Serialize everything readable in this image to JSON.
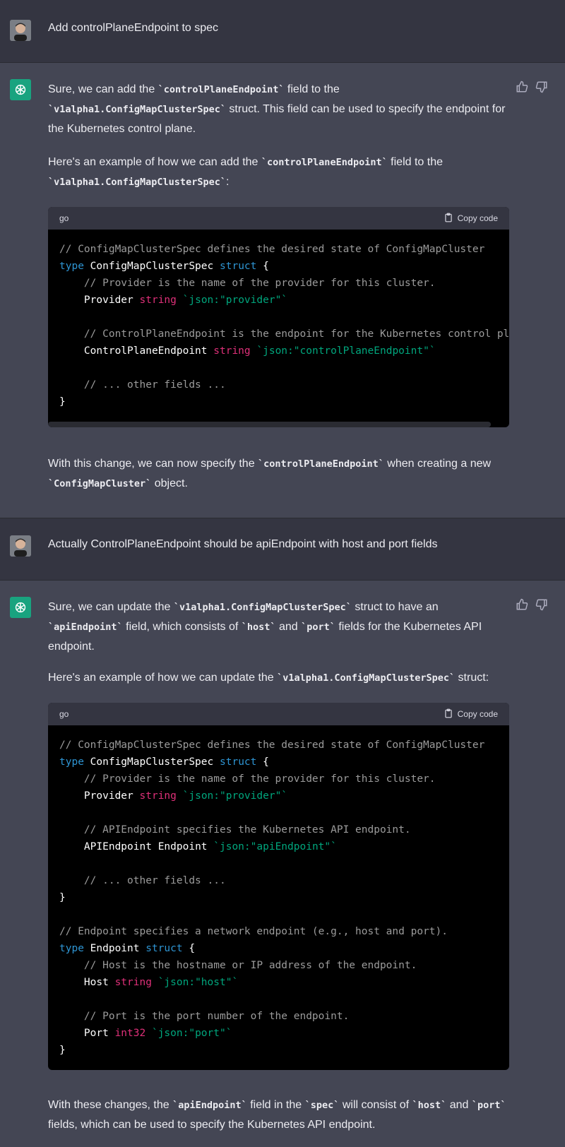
{
  "messages": {
    "user1": "Add controlPlaneEndpoint to spec",
    "asst1": {
      "p1_a": "Sure, we can add the ",
      "p1_code1": "`controlPlaneEndpoint`",
      "p1_b": " field to the ",
      "p1_code2": "`v1alpha1.ConfigMapClusterSpec`",
      "p1_c": " struct. This field can be used to specify the endpoint for the Kubernetes control plane.",
      "p2_a": "Here's an example of how we can add the ",
      "p2_code1": "`controlPlaneEndpoint`",
      "p2_b": " field to the ",
      "p2_code2": "`v1alpha1.ConfigMapClusterSpec`",
      "p2_c": ":",
      "p3_a": "With this change, we can now specify the ",
      "p3_code1": "`controlPlaneEndpoint`",
      "p3_b": " when creating a new ",
      "p3_code2": "`ConfigMapCluster`",
      "p3_c": " object."
    },
    "user2": "Actually ControlPlaneEndpoint should be apiEndpoint with host and port fields",
    "asst2": {
      "p1_a": "Sure, we can update the ",
      "p1_code1": "`v1alpha1.ConfigMapClusterSpec`",
      "p1_b": " struct to have an ",
      "p1_code2": "`apiEndpoint`",
      "p1_c": " field, which consists of ",
      "p1_code3": "`host`",
      "p1_d": " and ",
      "p1_code4": "`port`",
      "p1_e": " fields for the Kubernetes API endpoint.",
      "p2_a": "Here's an example of how we can update the ",
      "p2_code1": "`v1alpha1.ConfigMapClusterSpec`",
      "p2_b": " struct:",
      "p3_a": "With these changes, the ",
      "p3_code1": "`apiEndpoint`",
      "p3_b": " field in the ",
      "p3_code2": "`spec`",
      "p3_c": " will consist of ",
      "p3_code3": "`host`",
      "p3_d": " and ",
      "p3_code4": "`port`",
      "p3_e": " fields, which can be used to specify the Kubernetes API endpoint."
    }
  },
  "codeblock": {
    "language": "go",
    "copy_label": "Copy code"
  },
  "code1": {
    "l1": "// ConfigMapClusterSpec defines the desired state of ConfigMapCluster",
    "type": "type",
    "name": "ConfigMapClusterSpec",
    "struct": "struct",
    "open": "{",
    "l3": "// Provider is the name of the provider for this cluster.",
    "provider": "Provider",
    "string": "string",
    "provider_tag": "`json:\"provider\"`",
    "l6": "// ControlPlaneEndpoint is the endpoint for the Kubernetes control plane",
    "cpe": "ControlPlaneEndpoint",
    "cpe_tag": "`json:\"controlPlaneEndpoint\"`",
    "other": "// ... other fields ...",
    "close": "}"
  },
  "code2": {
    "l1": "// ConfigMapClusterSpec defines the desired state of ConfigMapCluster",
    "type": "type",
    "name": "ConfigMapClusterSpec",
    "struct": "struct",
    "open": "{",
    "l3": "// Provider is the name of the provider for this cluster.",
    "provider": "Provider",
    "string": "string",
    "provider_tag": "`json:\"provider\"`",
    "l6": "// APIEndpoint specifies the Kubernetes API endpoint.",
    "api": "APIEndpoint",
    "endpoint_type": "Endpoint",
    "api_tag": "`json:\"apiEndpoint\"`",
    "other": "// ... other fields ...",
    "close": "}",
    "l12": "// Endpoint specifies a network endpoint (e.g., host and port).",
    "ename": "Endpoint",
    "l14": "// Host is the hostname or IP address of the endpoint.",
    "host": "Host",
    "host_tag": "`json:\"host\"`",
    "l17": "// Port is the port number of the endpoint.",
    "port": "Port",
    "int32": "int32",
    "port_tag": "`json:\"port\"`"
  },
  "colors": {
    "user_bg": "#343541",
    "assistant_bg": "#444654",
    "bot_avatar": "#19a37f",
    "keyword": "#2e95d3",
    "type": "#df3079",
    "string": "#00a67d",
    "comment": "#9b9b9b"
  }
}
